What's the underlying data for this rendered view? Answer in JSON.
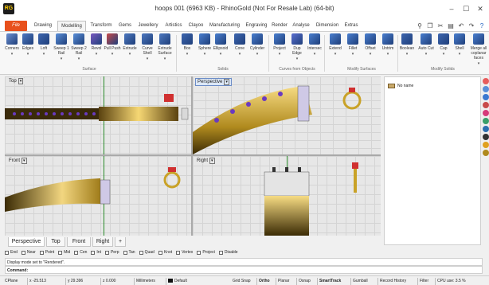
{
  "window": {
    "title": "hoops 001 (6963 KB) - RhinoGold (Not For Resale Lab) (64-bit)",
    "app_icon": "RG",
    "minimize": "–",
    "maximize": "☐",
    "close": "✕"
  },
  "tabs": [
    {
      "label": "File"
    },
    {
      "label": "Drawing"
    },
    {
      "label": "Modelling"
    },
    {
      "label": "Transform"
    },
    {
      "label": "Gems"
    },
    {
      "label": "Jewellery"
    },
    {
      "label": "Artistics"
    },
    {
      "label": "Clayoo"
    },
    {
      "label": "Manufacturing"
    },
    {
      "label": "Engraving"
    },
    {
      "label": "Render"
    },
    {
      "label": "Analyse"
    },
    {
      "label": "Dimension"
    },
    {
      "label": "Extras"
    }
  ],
  "ribbon": {
    "tools": [
      {
        "label": "Corners"
      },
      {
        "label": "Edges"
      },
      {
        "label": "Loft"
      },
      {
        "label": "Sweep 1 Rail"
      },
      {
        "label": "Sweep 2 Rail"
      },
      {
        "label": "Revol"
      },
      {
        "label": "Pull Push"
      },
      {
        "label": "Extrude"
      },
      {
        "label": "Curve Shell"
      },
      {
        "label": "Extrude Surface"
      },
      {
        "label": "Box"
      },
      {
        "label": "Sphere"
      },
      {
        "label": "Ellipsoid"
      },
      {
        "label": "Cone"
      },
      {
        "label": "Cylinder"
      },
      {
        "label": "Project"
      },
      {
        "label": "Dup Edge"
      },
      {
        "label": "Intersec"
      },
      {
        "label": "Extend"
      },
      {
        "label": "Fillet"
      },
      {
        "label": "Offset"
      },
      {
        "label": "Untrim"
      },
      {
        "label": "Boolean"
      },
      {
        "label": "Auto Cut"
      },
      {
        "label": "Cap"
      },
      {
        "label": "Shell"
      },
      {
        "label": "Merge all coplanar faces"
      }
    ],
    "groups": [
      {
        "label": "Surface"
      },
      {
        "label": "Solids"
      },
      {
        "label": "Curves from Objects"
      },
      {
        "label": "Modify Surfaces"
      },
      {
        "label": "Modify Solids"
      }
    ]
  },
  "viewports": {
    "top": {
      "label": "Top"
    },
    "perspective": {
      "label": "Perspective"
    },
    "front": {
      "label": "Front"
    },
    "right": {
      "label": "Right"
    }
  },
  "viewport_tabs": [
    {
      "label": "Perspective"
    },
    {
      "label": "Top"
    },
    {
      "label": "Front"
    },
    {
      "label": "Right"
    },
    {
      "label": "+"
    }
  ],
  "osnaps": [
    {
      "label": "End"
    },
    {
      "label": "Near"
    },
    {
      "label": "Point"
    },
    {
      "label": "Mid"
    },
    {
      "label": "Cen"
    },
    {
      "label": "Int"
    },
    {
      "label": "Perp"
    },
    {
      "label": "Tan"
    },
    {
      "label": "Quad"
    },
    {
      "label": "Knot"
    },
    {
      "label": "Vertex"
    },
    {
      "label": "Project"
    },
    {
      "label": "Disable"
    }
  ],
  "command": {
    "history": "Display mode set to \"Rendered\".",
    "prompt": "Command:",
    "value": ""
  },
  "status": {
    "cplane": "CPlane",
    "x": "x -25.513",
    "y": "y 29.396",
    "z": "z 0.000",
    "units": "Millimeters",
    "layer": "Default",
    "grid_snap": "Grid Snap",
    "ortho": "Ortho",
    "planar": "Planar",
    "osnap": "Osnap",
    "smarttrack": "SmartTrack",
    "gumball": "Gumball",
    "record_history": "Record History",
    "filter": "Filter",
    "cpu": "CPU use: 3.5 %"
  },
  "layers_panel": {
    "item": "No name"
  },
  "colors": {
    "accent": "#e8501c",
    "grid_axis_y": "#2a8a2a",
    "grid_axis_x": "#b24040",
    "gold": "#c9a227"
  }
}
